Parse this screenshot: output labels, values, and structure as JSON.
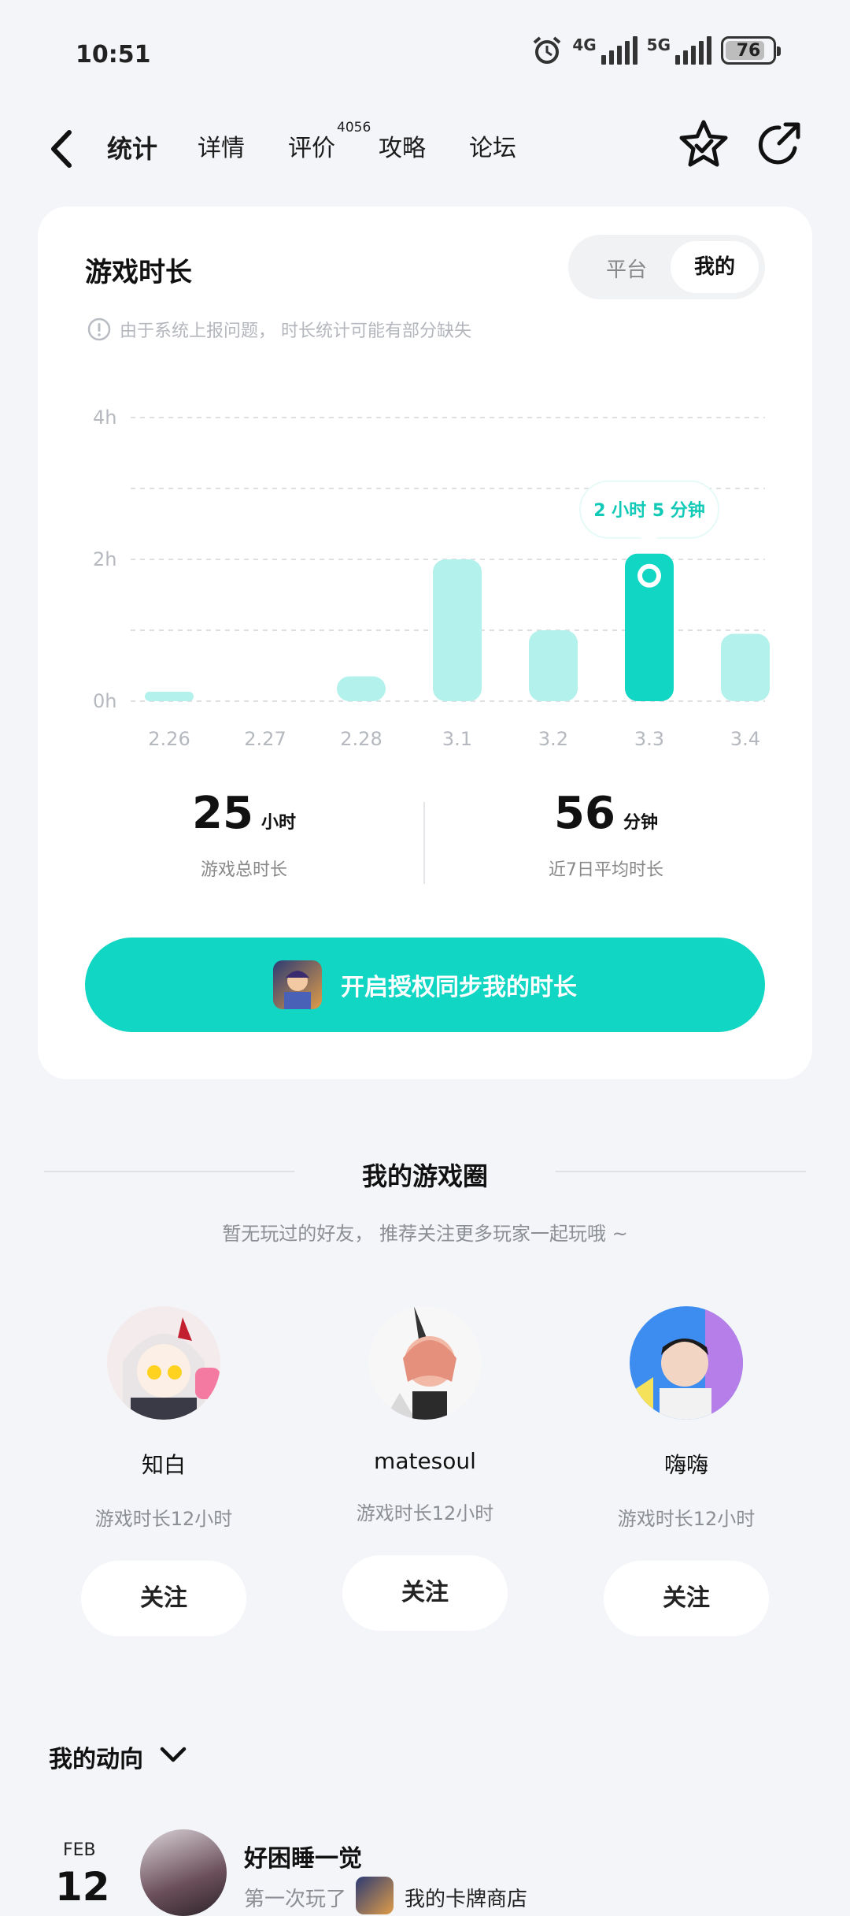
{
  "status_bar": {
    "time": "10:51",
    "network_1": "4G",
    "network_2": "5G",
    "battery": "76"
  },
  "nav": {
    "tabs": [
      {
        "label": "统计",
        "active": true
      },
      {
        "label": "详情"
      },
      {
        "label": "评价",
        "badge": "4056"
      },
      {
        "label": "攻略"
      },
      {
        "label": "论坛"
      }
    ],
    "icons": [
      "back-icon",
      "favorite-star-icon",
      "share-icon"
    ]
  },
  "playtime_card": {
    "title": "游戏时长",
    "toggle": {
      "platform": "平台",
      "mine": "我的",
      "selected": "我的"
    },
    "notice": "由于系统上报问题， 时长统计可能有部分缺失",
    "tooltip": "2 小时 5 分钟",
    "stats": {
      "total_value": "25",
      "total_unit": "小时",
      "total_label": "游戏总时长",
      "avg_value": "56",
      "avg_unit": "分钟",
      "avg_label": "近7日平均时长"
    },
    "sync_button": "开启授权同步我的时长",
    "accent_color": "#10d6c3"
  },
  "chart_data": {
    "type": "bar",
    "categories": [
      "2.26",
      "2.27",
      "2.28",
      "3.1",
      "3.2",
      "3.3",
      "3.4"
    ],
    "values": [
      0.12,
      0,
      0.35,
      2.0,
      1.0,
      2.08,
      0.95
    ],
    "highlight_index": 5,
    "y_ticks": [
      "0h",
      "2h",
      "4h"
    ],
    "ylim": [
      0,
      4
    ],
    "unit": "h",
    "grid": true,
    "bar_color": "#b3f2ec",
    "highlight_color": "#10d6c3"
  },
  "game_circle": {
    "title": "我的游戏圈",
    "subtitle": "暂无玩过的好友， 推荐关注更多玩家一起玩哦 ~",
    "friends": [
      {
        "name": "知白",
        "playtime": "游戏时长12小时",
        "follow": "关注"
      },
      {
        "name": "matesoul",
        "playtime": "游戏时长12小时",
        "follow": "关注"
      },
      {
        "name": "嗨嗨",
        "playtime": "游戏时长12小时",
        "follow": "关注"
      }
    ]
  },
  "activity": {
    "title": "我的动向",
    "items": [
      {
        "month": "FEB",
        "day": "12",
        "user": "好困睡一觉",
        "prefix": "第一次玩了",
        "game": "我的卡牌商店"
      }
    ]
  }
}
